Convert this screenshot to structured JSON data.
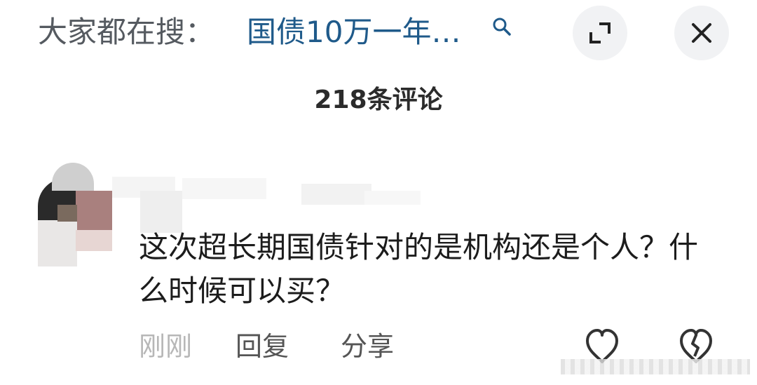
{
  "header": {
    "search_prefix": "大家都在搜：",
    "search_query": "国债10万一年…",
    "icons": {
      "search": "search-icon",
      "expand": "expand-icon",
      "close": "close-icon"
    }
  },
  "comments": {
    "count_label": "218条评论",
    "items": [
      {
        "text": "这次超长期国债针对的是机构还是个人？什么时候可以买？",
        "time": "刚刚",
        "reply_label": "回复",
        "share_label": "分享"
      }
    ]
  },
  "colors": {
    "query_link": "#1f5a8a",
    "button_bg": "#f1f2f4",
    "muted_text": "#b7b7b7"
  }
}
